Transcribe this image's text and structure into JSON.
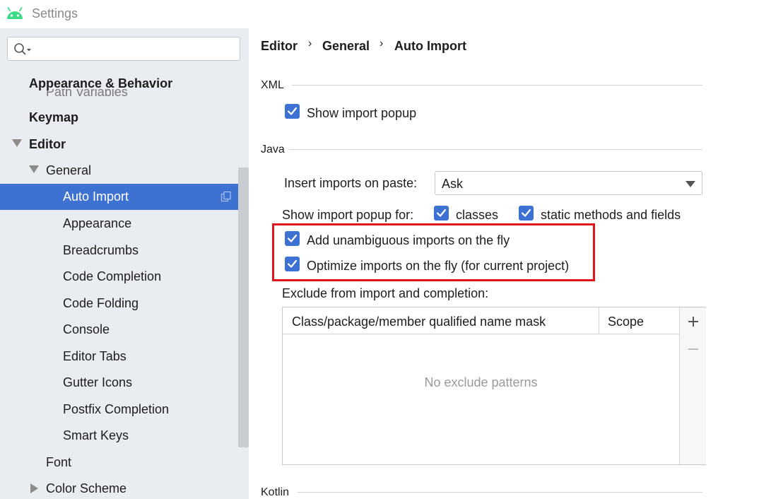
{
  "window": {
    "title": "Settings"
  },
  "search": {
    "value": "",
    "placeholder": ""
  },
  "sidebar": {
    "overlap_text": "Path Variables",
    "items": [
      {
        "label": "Appearance & Behavior"
      },
      {
        "label": "Keymap"
      },
      {
        "label": "Editor"
      },
      {
        "label": "General"
      },
      {
        "label": "Auto Import"
      },
      {
        "label": "Appearance"
      },
      {
        "label": "Breadcrumbs"
      },
      {
        "label": "Code Completion"
      },
      {
        "label": "Code Folding"
      },
      {
        "label": "Console"
      },
      {
        "label": "Editor Tabs"
      },
      {
        "label": "Gutter Icons"
      },
      {
        "label": "Postfix Completion"
      },
      {
        "label": "Smart Keys"
      },
      {
        "label": "Font"
      },
      {
        "label": "Color Scheme"
      }
    ]
  },
  "breadcrumb": {
    "items": [
      "Editor",
      "General",
      "Auto Import"
    ],
    "separator": "›"
  },
  "xml": {
    "title": "XML",
    "show_popup": {
      "label": "Show import popup",
      "checked": true
    }
  },
  "java": {
    "title": "Java",
    "insert_on_paste": {
      "label": "Insert imports on paste:",
      "value": "Ask"
    },
    "show_popup_for": {
      "label": "Show import popup for:",
      "classes": {
        "label": "classes",
        "checked": true
      },
      "static": {
        "label": "static methods and fields",
        "checked": true
      }
    },
    "add_unambiguous": {
      "label": "Add unambiguous imports on the fly",
      "checked": true
    },
    "optimize": {
      "label": "Optimize imports on the fly (for current project)",
      "checked": true
    },
    "exclude": {
      "label": "Exclude from import and completion:",
      "columns": [
        "Class/package/member qualified name mask",
        "Scope"
      ],
      "empty_text": "No exclude patterns"
    }
  },
  "kotlin": {
    "title": "Kotlin"
  },
  "colors": {
    "accent": "#3d72d2",
    "highlight": "#e0141b",
    "sidebar_bg": "#e9edf1"
  },
  "icons": {
    "app": "android-icon",
    "search": "search-icon",
    "copy": "copy-icon",
    "add": "plus-icon",
    "remove": "minus-icon"
  }
}
